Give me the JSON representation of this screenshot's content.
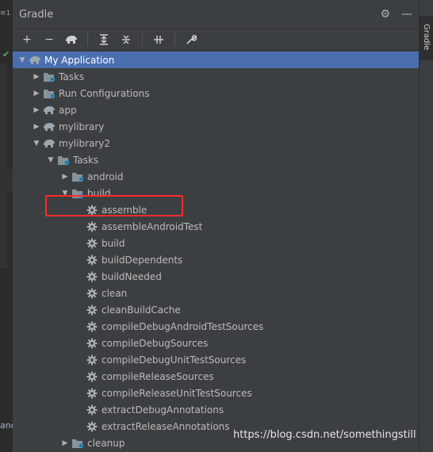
{
  "left_strip": {
    "tab_text": "≡1",
    "code_text": "anc"
  },
  "panel": {
    "title": "Gradle"
  },
  "right_sidebar": {
    "tab_label": "Gradle"
  },
  "toolbar": {
    "items": [
      "add-icon",
      "remove-icon",
      "gradle-elephant-icon",
      "expand-all-icon",
      "collapse-all-icon",
      "toggle-offline-icon",
      "wrench-icon"
    ]
  },
  "tree": {
    "rows": [
      {
        "indent": 0,
        "arrow": "down",
        "icon": "elephant",
        "label": "My Application",
        "selected": true
      },
      {
        "indent": 1,
        "arrow": "right",
        "icon": "folder-gear",
        "label": "Tasks"
      },
      {
        "indent": 1,
        "arrow": "right",
        "icon": "folder-gear",
        "label": "Run Configurations"
      },
      {
        "indent": 1,
        "arrow": "right",
        "icon": "elephant",
        "label": "app"
      },
      {
        "indent": 1,
        "arrow": "right",
        "icon": "elephant",
        "label": "mylibrary"
      },
      {
        "indent": 1,
        "arrow": "down",
        "icon": "elephant",
        "label": "mylibrary2"
      },
      {
        "indent": 2,
        "arrow": "down",
        "icon": "folder-gear",
        "label": "Tasks"
      },
      {
        "indent": 3,
        "arrow": "right",
        "icon": "folder-gear",
        "label": "android"
      },
      {
        "indent": 3,
        "arrow": "down",
        "icon": "folder-gear",
        "label": "build"
      },
      {
        "indent": 4,
        "arrow": "none",
        "icon": "gear",
        "label": "assemble"
      },
      {
        "indent": 4,
        "arrow": "none",
        "icon": "gear",
        "label": "assembleAndroidTest"
      },
      {
        "indent": 4,
        "arrow": "none",
        "icon": "gear",
        "label": "build"
      },
      {
        "indent": 4,
        "arrow": "none",
        "icon": "gear",
        "label": "buildDependents"
      },
      {
        "indent": 4,
        "arrow": "none",
        "icon": "gear",
        "label": "buildNeeded"
      },
      {
        "indent": 4,
        "arrow": "none",
        "icon": "gear",
        "label": "clean"
      },
      {
        "indent": 4,
        "arrow": "none",
        "icon": "gear",
        "label": "cleanBuildCache"
      },
      {
        "indent": 4,
        "arrow": "none",
        "icon": "gear",
        "label": "compileDebugAndroidTestSources"
      },
      {
        "indent": 4,
        "arrow": "none",
        "icon": "gear",
        "label": "compileDebugSources"
      },
      {
        "indent": 4,
        "arrow": "none",
        "icon": "gear",
        "label": "compileDebugUnitTestSources"
      },
      {
        "indent": 4,
        "arrow": "none",
        "icon": "gear",
        "label": "compileReleaseSources"
      },
      {
        "indent": 4,
        "arrow": "none",
        "icon": "gear",
        "label": "compileReleaseUnitTestSources"
      },
      {
        "indent": 4,
        "arrow": "none",
        "icon": "gear",
        "label": "extractDebugAnnotations"
      },
      {
        "indent": 4,
        "arrow": "none",
        "icon": "gear",
        "label": "extractReleaseAnnotations"
      },
      {
        "indent": 3,
        "arrow": "right",
        "icon": "folder-gear",
        "label": "cleanup"
      }
    ]
  },
  "watermark": "https://blog.csdn.net/somethingstill",
  "colors": {
    "selection": "#4b6eaf",
    "highlight_box": "#ff2b2b",
    "panel_bg": "#3c3f41"
  }
}
